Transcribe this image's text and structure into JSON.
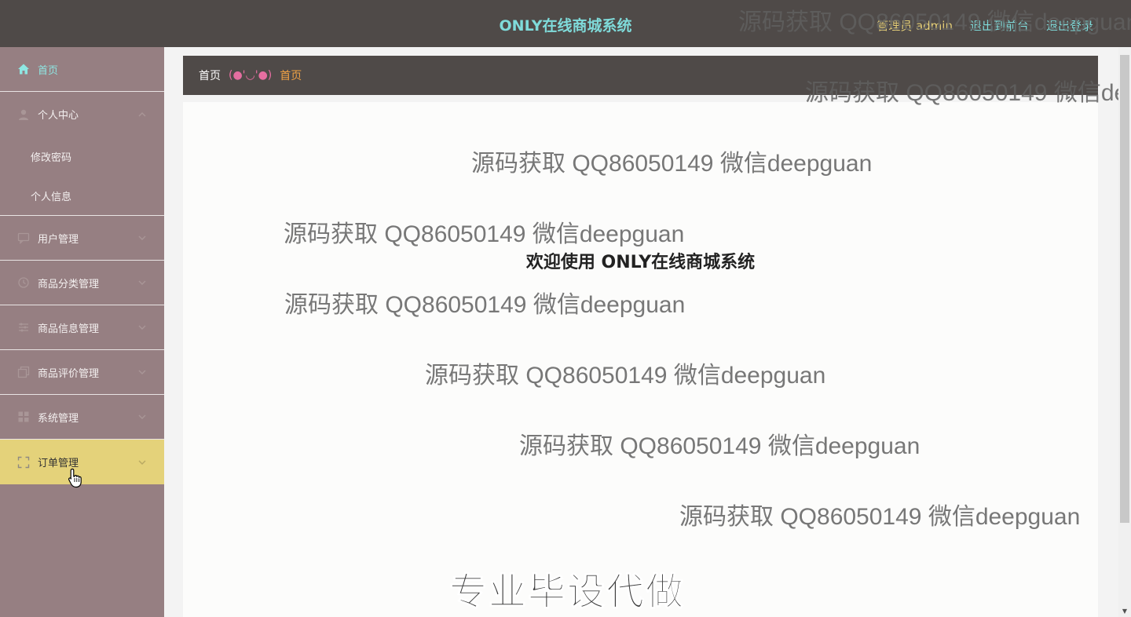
{
  "header": {
    "title": "ONLY在线商城系统",
    "admin_label": "管理员 admin",
    "back_to_front": "退出到前台",
    "logout": "退出登录"
  },
  "sidebar": {
    "home": "首页",
    "personal_center": "个人中心",
    "change_password": "修改密码",
    "personal_info": "个人信息",
    "items": [
      {
        "label": "用户管理",
        "icon": "chat-icon"
      },
      {
        "label": "商品分类管理",
        "icon": "clock-icon"
      },
      {
        "label": "商品信息管理",
        "icon": "sliders-icon"
      },
      {
        "label": "商品评价管理",
        "icon": "copy-icon"
      },
      {
        "label": "系统管理",
        "icon": "grid-icon"
      },
      {
        "label": "订单管理",
        "icon": "fullscreen-icon"
      }
    ]
  },
  "breadcrumb": {
    "home": "首页",
    "face": "(●'◡'●)",
    "current": "首页"
  },
  "main": {
    "welcome": "欢迎使用 ONLY在线商城系统"
  },
  "watermark": {
    "text": "源码获取 QQ86050149 微信deepguan",
    "badge": "专业毕设代做"
  },
  "colors": {
    "header_bg": "#4f4a48",
    "sidebar_bg": "#967f82",
    "active_item_bg": "#e4d27a",
    "title_color": "#7fdbda",
    "admin_color": "#e5cf78"
  }
}
